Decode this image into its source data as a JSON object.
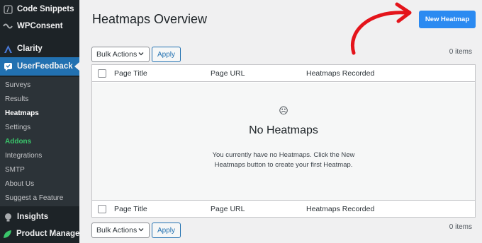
{
  "sidebar": {
    "top_items": [
      {
        "label": "Code Snippets",
        "icon": "code-snippets-icon"
      },
      {
        "label": "WPConsent",
        "icon": "wpconsent-icon"
      },
      {
        "label": "Clarity",
        "icon": "clarity-icon"
      },
      {
        "label": "UserFeedback",
        "icon": "userfeedback-icon"
      }
    ],
    "submenu": [
      {
        "label": "Surveys"
      },
      {
        "label": "Results"
      },
      {
        "label": "Heatmaps"
      },
      {
        "label": "Settings"
      },
      {
        "label": "Addons"
      },
      {
        "label": "Integrations"
      },
      {
        "label": "SMTP"
      },
      {
        "label": "About Us"
      },
      {
        "label": "Suggest a Feature"
      }
    ],
    "bottom_items": [
      {
        "label": "Insights",
        "icon": "insights-icon"
      },
      {
        "label": "Product Manager",
        "icon": "product-manager-icon"
      }
    ]
  },
  "main": {
    "title": "Heatmaps Overview",
    "new_button": "New Heatmap",
    "bulk_actions": "Bulk Actions",
    "apply": "Apply",
    "item_count": "0 items",
    "columns": [
      "Page Title",
      "Page URL",
      "Heatmaps Recorded"
    ],
    "empty": {
      "icon": "☹",
      "title": "No Heatmaps",
      "description": "You currently have no Heatmaps. Click the New Heatmaps button to create your first Heatmap."
    }
  },
  "colors": {
    "sidebar_bg": "#1d2327",
    "submenu_bg": "#2c3338",
    "active_menu": "#2271b1",
    "primary_button": "#2b8af1",
    "addons_green": "#3ac66b",
    "annotation_red": "#e4141b"
  }
}
